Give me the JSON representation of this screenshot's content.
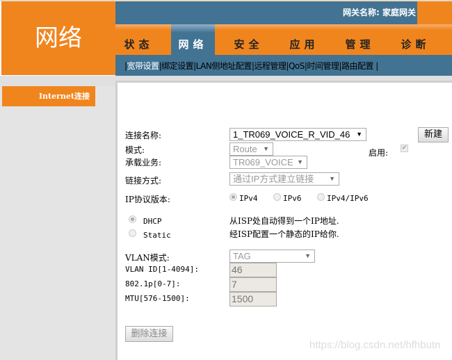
{
  "logo": "网络",
  "header": {
    "gateway": "网关名称: 家庭网关"
  },
  "tabs": [
    {
      "label": "状态"
    },
    {
      "label": "网络",
      "active": true
    },
    {
      "label": "安全"
    },
    {
      "label": "应用"
    },
    {
      "label": "管理"
    },
    {
      "label": "诊断"
    }
  ],
  "subnav": [
    "宽带设置",
    "绑定设置",
    "LAN侧地址配置",
    "远程管理",
    "QoS",
    "时间管理",
    "路由配置"
  ],
  "sidebar": {
    "items": [
      {
        "label": "Internet连接"
      }
    ]
  },
  "form": {
    "conn_name_label": "连接名称:",
    "conn_name_value": "1_TR069_VOICE_R_VID_46",
    "new_button": "新建",
    "mode_label": "模式:",
    "mode_value": "Route",
    "enable_label": "启用:",
    "enable_checked": true,
    "service_label": "承载业务:",
    "service_value": "TR069_VOICE",
    "link_label": "链接方式:",
    "link_value": "通过IP方式建立链接",
    "ipver_label": "IP协议版本:",
    "ipver_options": [
      "IPv4",
      "IPv6",
      "IPv4/IPv6"
    ],
    "ipver_selected": "IPv4",
    "dhcp_label": "DHCP",
    "dhcp_desc": "从ISP处自动得到一个IP地址.",
    "static_label": "Static",
    "static_desc": "经ISP配置一个静态的IP给你.",
    "vlan_mode_label": "VLAN模式:",
    "vlan_mode_value": "TAG",
    "vlan_id_label": "VLAN ID[1-4094]:",
    "vlan_id_value": "46",
    "p8021_label": "802.1p[0-7]:",
    "p8021_value": "7",
    "mtu_label": "MTU[576-1500]:",
    "mtu_value": "1500",
    "delete_button": "删除连接"
  },
  "watermark": "https://blog.csdn.net/hfhbutn",
  "colors": {
    "orange": "#f0851e",
    "blue": "#427393"
  }
}
